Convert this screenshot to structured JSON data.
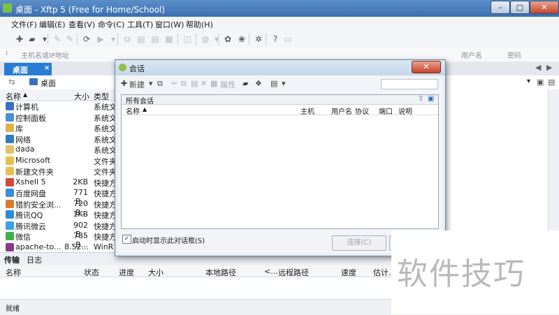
{
  "window": {
    "title": "桌面 - Xftp 5 (Free for Home/School)",
    "minimize": "–",
    "maximize": "□",
    "close": "✕"
  },
  "menu": [
    "文件(F)",
    "编辑(E)",
    "查看(V)",
    "命令(C)",
    "工具(T)",
    "窗口(W)",
    "帮助(H)"
  ],
  "address": {
    "placeholder": "主机名或IP地址",
    "user_label": "用户名",
    "password_label": "密码"
  },
  "tabs": [
    {
      "label": "桌面",
      "close": "×"
    }
  ],
  "path": {
    "current": "桌面"
  },
  "file_list": {
    "columns": [
      "名称",
      "大小",
      "类型"
    ],
    "rows": [
      {
        "name": "计算机",
        "size": "",
        "type": "系统文",
        "icon_color": "#3a6fc4"
      },
      {
        "name": "控制面板",
        "size": "",
        "type": "系统文",
        "icon_color": "#4b8fd6"
      },
      {
        "name": "库",
        "size": "",
        "type": "系统文",
        "icon_color": "#e0b34a"
      },
      {
        "name": "网络",
        "size": "",
        "type": "系统文",
        "icon_color": "#2f7ac0"
      },
      {
        "name": "dada",
        "size": "",
        "type": "系统文",
        "icon_color": "#e2c36a"
      },
      {
        "name": "Microsoft",
        "size": "",
        "type": "文件夹",
        "icon_color": "#e8c050"
      },
      {
        "name": "新建文件夹",
        "size": "",
        "type": "文件夹",
        "icon_color": "#e8c050"
      },
      {
        "name": "Xshell 5",
        "size": "2KB",
        "type": "快捷方",
        "icon_color": "#d24a3a"
      },
      {
        "name": "百度网盘",
        "size": "771 B...",
        "type": "快捷方",
        "icon_color": "#3d8be0"
      },
      {
        "name": "猎豹安全浏...",
        "size": "720 B...",
        "type": "快捷方",
        "icon_color": "#e07a2a"
      },
      {
        "name": "腾讯QQ",
        "size": "1KB",
        "type": "快捷方",
        "icon_color": "#2f8ad8"
      },
      {
        "name": "腾讯微云",
        "size": "902 B...",
        "type": "快捷方",
        "icon_color": "#3aa0e8"
      },
      {
        "name": "微信",
        "size": "785 B...",
        "type": "快捷方",
        "icon_color": "#3fb04a"
      },
      {
        "name": "apache-to...",
        "size": "8.52...",
        "type": "WinR",
        "icon_color": "#8a3a8a"
      }
    ]
  },
  "transfer": {
    "tabs": [
      "传输",
      "日志"
    ],
    "columns": [
      "名称",
      "状态",
      "进度",
      "大小",
      "本地路径",
      "<...",
      "远程路径",
      "速度",
      "估计..."
    ]
  },
  "status_text": "就绪",
  "dialog": {
    "title": "会话",
    "close": "✕",
    "new_label": "新建",
    "properties_label": "属性",
    "folder_label": "所有会话",
    "columns": [
      "名称",
      "主机",
      "用户名",
      "协议",
      "端口",
      "说明"
    ],
    "checkbox_label": "启动时显示此对话框(S)",
    "checkbox_checked": true,
    "connect_label": "连接(C)"
  },
  "watermark": "软件技巧"
}
